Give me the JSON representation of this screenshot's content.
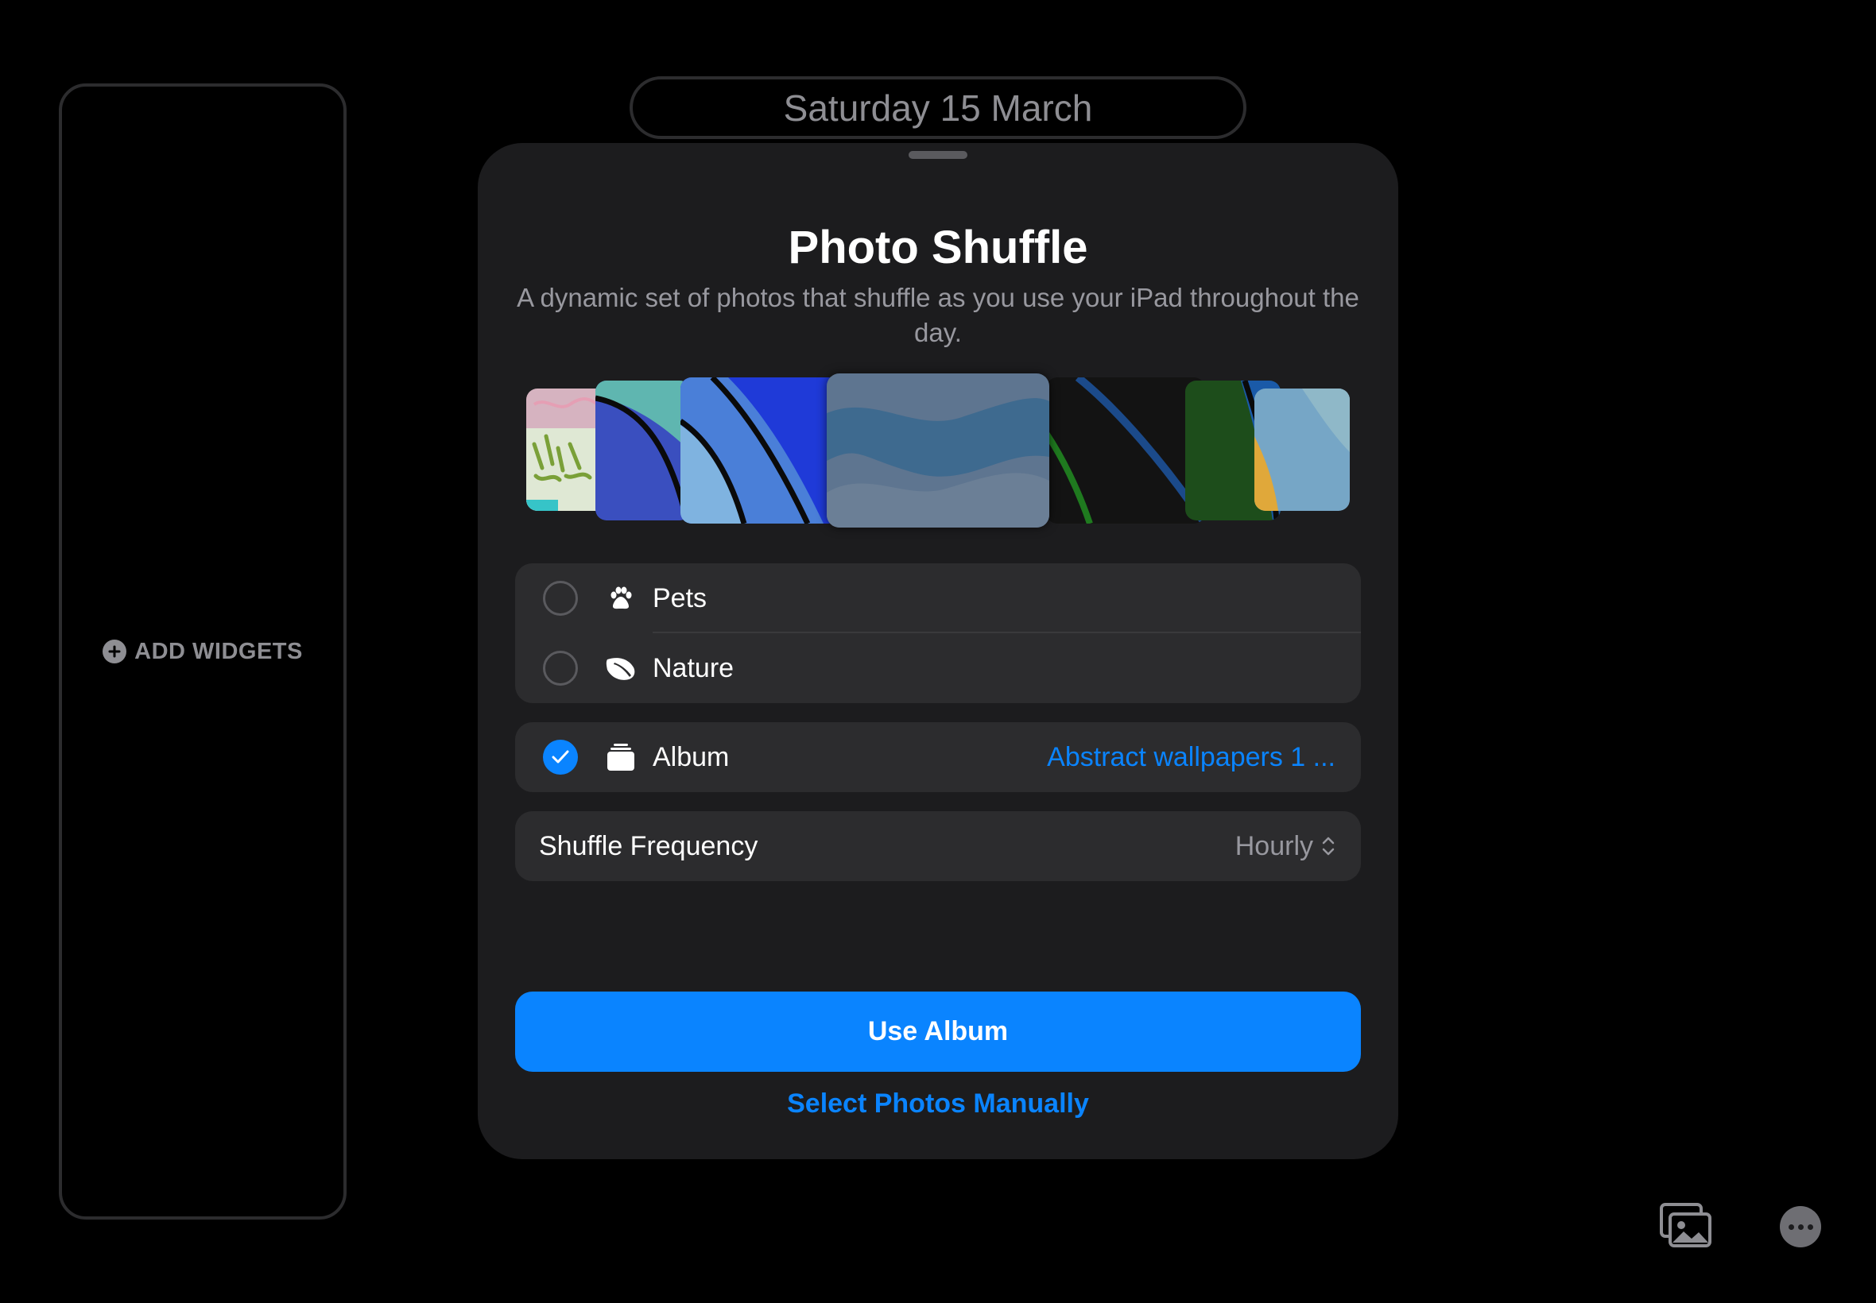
{
  "lock_screen": {
    "date": "Saturday 15 March",
    "widgets": {
      "add_label": "ADD WIDGETS"
    }
  },
  "sheet": {
    "title": "Photo Shuffle",
    "subtitle": "A dynamic set of photos that shuffle as you use your iPad throughout the day.",
    "options": [
      {
        "label": "Pets",
        "icon": "paw-icon",
        "selected": false
      },
      {
        "label": "Nature",
        "icon": "leaf-icon",
        "selected": false
      }
    ],
    "album": {
      "label": "Album",
      "icon": "album-stack-icon",
      "selected": true,
      "value": "Abstract wallpapers 1 ..."
    },
    "frequency": {
      "label": "Shuffle Frequency",
      "value": "Hourly"
    },
    "primary_button": "Use Album",
    "secondary_button": "Select Photos Manually"
  },
  "colors": {
    "accent": "#0a84ff",
    "sheet_bg": "#1c1c1e",
    "row_bg": "#2c2c2e",
    "secondary_text": "#98989f"
  }
}
